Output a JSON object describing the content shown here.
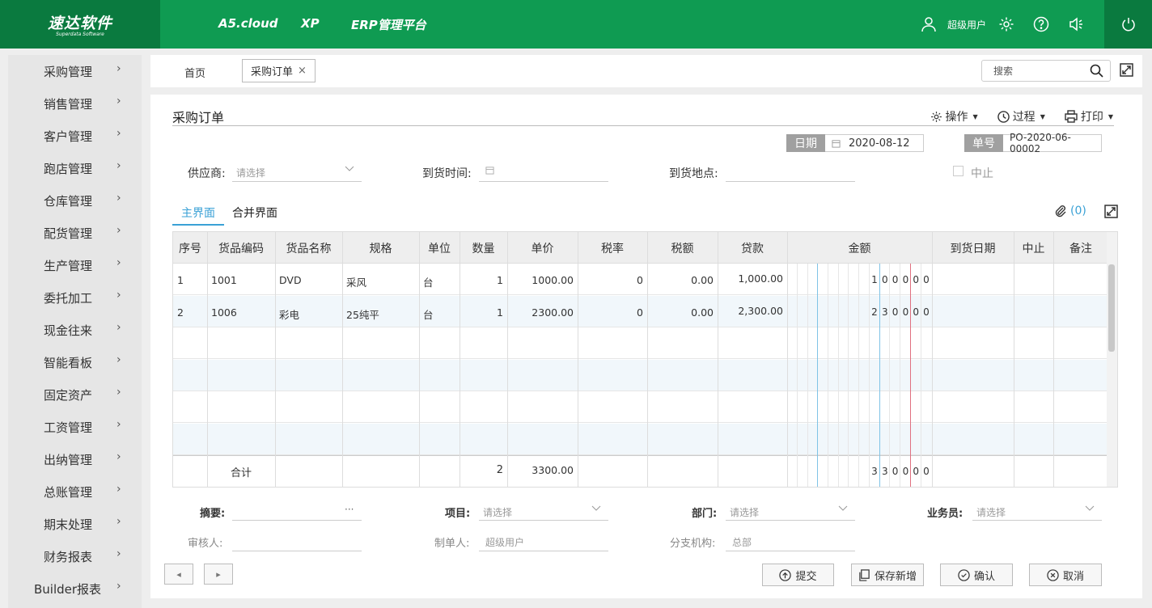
{
  "brand": {
    "name": "速达软件",
    "sub": "Superdata Software"
  },
  "topnav": [
    "A5.cloud",
    "XP",
    "ERP管理平台"
  ],
  "user": {
    "name": "超级用户"
  },
  "sidebar": {
    "items": [
      "采购管理",
      "销售管理",
      "客户管理",
      "跑店管理",
      "仓库管理",
      "配货管理",
      "生产管理",
      "委托加工",
      "现金往来",
      "智能看板",
      "固定资产",
      "工资管理",
      "出纳管理",
      "总账管理",
      "期末处理",
      "财务报表",
      "Builder报表"
    ]
  },
  "tabs": {
    "home": "首页",
    "active": "采购订单",
    "close": "×"
  },
  "search": {
    "placeholder": "搜索"
  },
  "page": {
    "title": "采购订单",
    "ops": "操作",
    "process": "过程",
    "print": "打印"
  },
  "header": {
    "date_label": "日期",
    "date": "2020-08-12",
    "no_label": "单号",
    "no": "PO-2020-06-00002"
  },
  "form": {
    "supplier_label": "供应商:",
    "supplier_ph": "请选择",
    "arrive_time_label": "到货时间:",
    "arrive_place_label": "到货地点:",
    "stop_label": "中止"
  },
  "subtabs": {
    "main": "主界面",
    "merge": "合并界面",
    "attach": "(0)"
  },
  "grid": {
    "headers": [
      "序号",
      "货品编码",
      "货品名称",
      "规格",
      "单位",
      "数量",
      "单价",
      "税率",
      "税额",
      "贷款",
      "金额",
      "到货日期",
      "中止",
      "备注"
    ],
    "rows": [
      {
        "no": "1",
        "code": "1001",
        "name": "DVD",
        "spec": "采风",
        "unit": "台",
        "qty": "1",
        "price": "1000.00",
        "rate": "0",
        "tax": "0.00",
        "loan": "1,000.00",
        "digits": [
          "1",
          "0",
          "0",
          "0",
          "0",
          "0"
        ]
      },
      {
        "no": "2",
        "code": "1006",
        "name": "彩电",
        "spec": "25纯平",
        "unit": "台",
        "qty": "1",
        "price": "2300.00",
        "rate": "0",
        "tax": "0.00",
        "loan": "2,300.00",
        "digits": [
          "2",
          "3",
          "0",
          "0",
          "0",
          "0"
        ]
      }
    ],
    "total": {
      "label": "合计",
      "qty": "2",
      "price": "3300.00",
      "digits": [
        "3",
        "3",
        "0",
        "0",
        "0",
        "0"
      ]
    }
  },
  "footer_form": {
    "summary_label": "摘要:",
    "summary_more": "···",
    "project_label": "项目:",
    "project_ph": "请选择",
    "dept_label": "部门:",
    "dept_ph": "请选择",
    "staff_label": "业务员:",
    "staff_ph": "请选择",
    "auditor_label": "审核人:",
    "maker_label": "制单人:",
    "maker_val": "超级用户",
    "branch_label": "分支机构:",
    "branch_val": "总部"
  },
  "buttons": {
    "prev": "◂",
    "next": "▸",
    "submit": "提交",
    "save_new": "保存新增",
    "confirm": "确认",
    "cancel": "取消"
  },
  "colors": {
    "topbar": "#0f9b52",
    "logo_bg": "#0a7a3f",
    "accent": "#3aa1d6"
  }
}
